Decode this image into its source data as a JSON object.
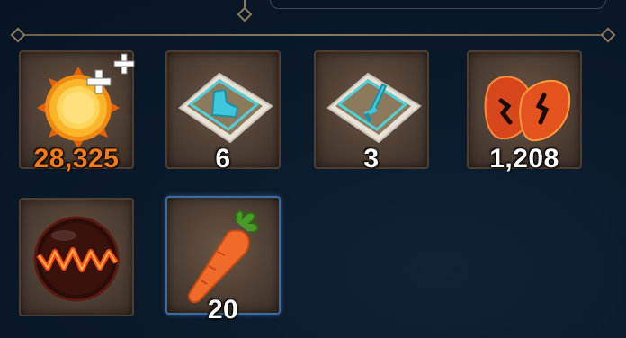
{
  "inventory": {
    "items": [
      {
        "icon": "sun-coin-icon",
        "count": "28,325",
        "color": "#f57c18"
      },
      {
        "icon": "boot-scroll-icon",
        "count": "6"
      },
      {
        "icon": "sword-scroll-icon",
        "count": "3"
      },
      {
        "icon": "red-leaves-icon",
        "count": "1,208"
      },
      {
        "icon": "lava-orb-icon",
        "count": ""
      },
      {
        "icon": "carrot-icon",
        "count": "20",
        "selected": true
      }
    ]
  }
}
